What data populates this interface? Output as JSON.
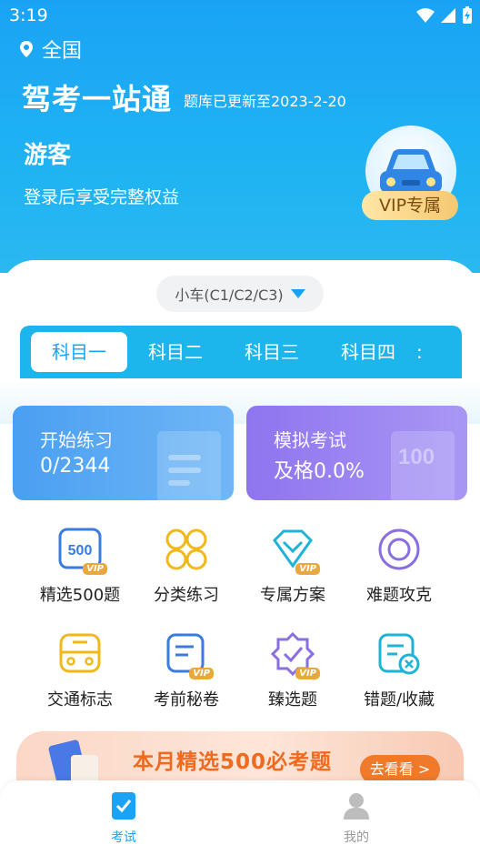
{
  "status_bar": {
    "time": "3:19"
  },
  "header": {
    "location": "全国",
    "app_title": "驾考一站通",
    "update_note": "题库已更新至2023-2-20",
    "guest_name": "游客",
    "login_hint": "登录后享受完整权益",
    "vip_badge": "VIP专属"
  },
  "vehicle_selector": {
    "selected": "小车(C1/C2/C3)"
  },
  "subject_tabs": [
    {
      "label": "科目一",
      "active": true
    },
    {
      "label": "科目二",
      "active": false
    },
    {
      "label": "科目三",
      "active": false
    },
    {
      "label": "科目四",
      "active": false
    }
  ],
  "cards": {
    "practice": {
      "title": "开始练习",
      "value": "0/2344"
    },
    "exam": {
      "title": "模拟考试",
      "value": "及格0.0%"
    }
  },
  "grid": [
    {
      "label": "精选500题",
      "icon": "vip-500-icon"
    },
    {
      "label": "分类练习",
      "icon": "category-icon"
    },
    {
      "label": "专属方案",
      "icon": "diamond-vip-icon"
    },
    {
      "label": "难题攻克",
      "icon": "target-icon"
    },
    {
      "label": "交通标志",
      "icon": "bus-icon"
    },
    {
      "label": "考前秘卷",
      "icon": "secret-paper-icon"
    },
    {
      "label": "臻选题",
      "icon": "badge-check-icon"
    },
    {
      "label": "错题/收藏",
      "icon": "wrong-favorites-icon"
    }
  ],
  "vip_tag_text": "VIP",
  "icon_500_text": "500",
  "deco_text": "100",
  "banner": {
    "title": "本月精选500必考题",
    "button": "去看看 >"
  },
  "bottom_nav": [
    {
      "label": "考试",
      "active": true
    },
    {
      "label": "我的",
      "active": false
    }
  ],
  "colors": {
    "primary": "#1aa3f5",
    "vip_gold": "#f6c870",
    "banner_orange": "#f06a1e",
    "exam_purple": "#8f74f0",
    "practice_blue": "#4a9ff2"
  }
}
